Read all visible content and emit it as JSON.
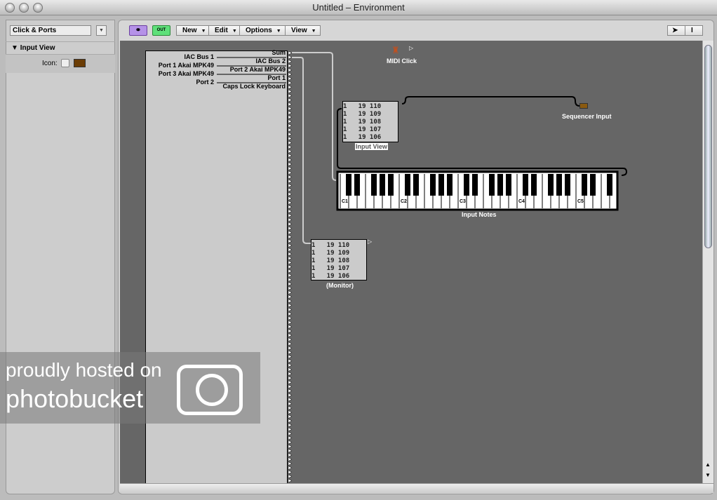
{
  "window": {
    "title": "Untitled – Environment"
  },
  "sidebar": {
    "layer_select": "Click & Ports",
    "section": "Input View",
    "icon_label": "Icon:"
  },
  "toolbar": {
    "link_button": "link",
    "midi_out_button": "OUT",
    "menus": [
      "New",
      "Edit",
      "Options",
      "View"
    ],
    "tools": [
      "pointer-tool",
      "text-tool"
    ]
  },
  "ports": {
    "inputs": [
      "IAC Bus 1",
      "Port 1 Akai MPK49",
      "Port 3 Akai MPK49",
      "Port 2"
    ],
    "outputs": [
      "Sum",
      "IAC Bus 2",
      "Port 2 Akai MPK49",
      "Port 1",
      "Caps Lock Keyboard"
    ]
  },
  "objects": {
    "midi_click": "MIDI Click",
    "sequencer_input": "Sequencer Input",
    "input_view": {
      "label": "Input View",
      "rows": [
        "1   19 110",
        "1   19 109",
        "1   19 108",
        "1   19 107",
        "1   19 106"
      ]
    },
    "monitor": {
      "label": "(Monitor)",
      "rows": [
        "1   19 110",
        "1   19 109",
        "1   19 108",
        "1   19 107",
        "1   19 106"
      ]
    },
    "keyboard": {
      "label": "Input Notes",
      "octave_labels": [
        "C1",
        "C2",
        "C3",
        "C4",
        "C5"
      ]
    }
  },
  "watermark": {
    "text1": "proudly hosted on",
    "text2": "photobucket"
  }
}
